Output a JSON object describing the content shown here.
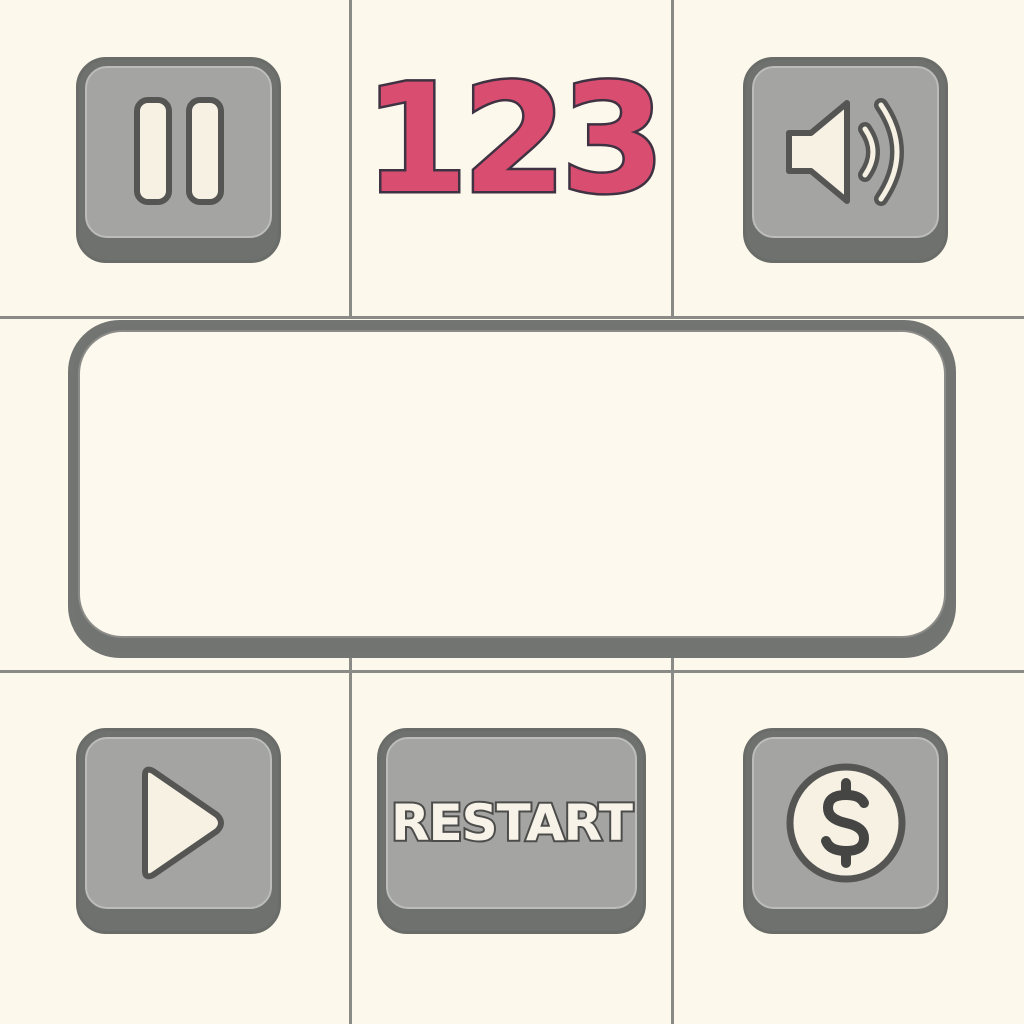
{
  "hud": {
    "score": "123"
  },
  "buttons": {
    "pause": {
      "icon": "pause-icon"
    },
    "sound": {
      "icon": "speaker-icon"
    },
    "play": {
      "icon": "play-icon"
    },
    "restart": {
      "label": "RESTART"
    },
    "shop": {
      "icon": "dollar-coin-icon"
    }
  },
  "colors": {
    "background": "#fdf8ec",
    "button_face": "#a4a4a2",
    "button_shadow": "#6f716e",
    "score_fill": "#d94e70",
    "score_outline": "#3f3242",
    "panel_fill": "#fef9ef",
    "grid_line": "#8a8a87"
  }
}
